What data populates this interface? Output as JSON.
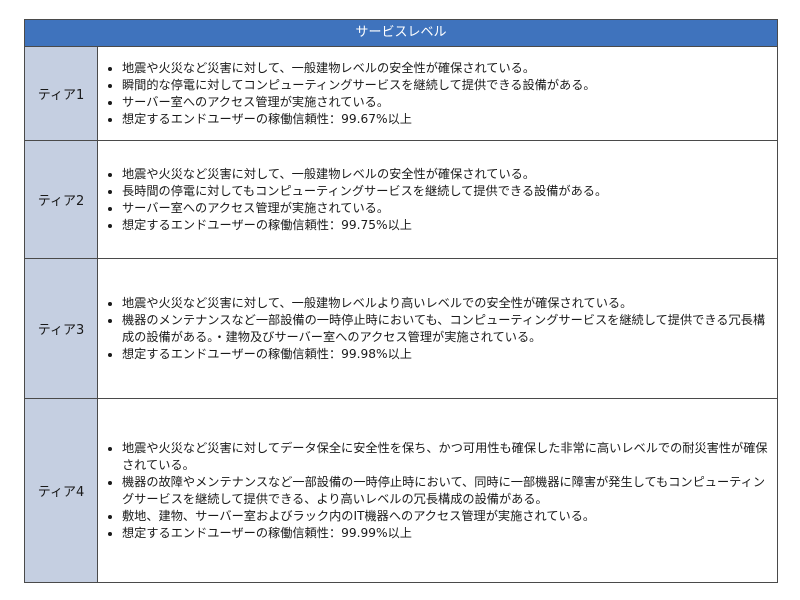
{
  "table": {
    "header": "サービスレベル",
    "tiers": [
      {
        "name": "ティア1",
        "items": [
          "地震や火災など災害に対して、一般建物レベルの安全性が確保されている。",
          "瞬間的な停電に対してコンピューティングサービスを継続して提供できる設備がある。",
          "サーバー室へのアクセス管理が実施されている。",
          "想定するエンドユーザーの稼働信頼性：99.67%以上"
        ]
      },
      {
        "name": "ティア2",
        "items": [
          "地震や火災など災害に対して、一般建物レベルの安全性が確保されている。",
          "長時間の停電に対してもコンピューティングサービスを継続して提供できる設備がある。",
          "サーバー室へのアクセス管理が実施されている。",
          "想定するエンドユーザーの稼働信頼性：99.75%以上"
        ]
      },
      {
        "name": "ティア3",
        "items": [
          "地震や火災など災害に対して、一般建物レベルより高いレベルでの安全性が確保されている。",
          "機器のメンテナンスなど一部設備の一時停止時においても、コンピューティングサービスを継続して提供できる冗長構成の設備がある。・建物及びサーバー室へのアクセス管理が実施されている。",
          "想定するエンドユーザーの稼働信頼性：99.98%以上"
        ]
      },
      {
        "name": "ティア4",
        "items": [
          "地震や火災など災害に対してデータ保全に安全性を保ち、かつ可用性も確保した非常に高いレベルでの耐災害性が確保されている。",
          "機器の故障やメンテナンスなど一部設備の一時停止時において、同時に一部機器に障害が発生してもコンピューティングサービスを継続して提供できる、より高いレベルの冗長構成の設備がある。",
          "敷地、建物、サーバー室およびラック内のIT機器へのアクセス管理が実施されている。",
          "想定するエンドユーザーの稼働信頼性：99.99%以上"
        ]
      }
    ]
  },
  "colors": {
    "header_bg": "#3f73bd",
    "tier_bg": "#c5cfe1",
    "border": "#4a4a4a"
  }
}
